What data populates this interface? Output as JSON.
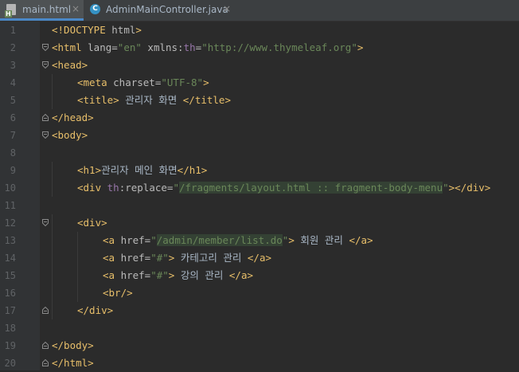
{
  "tabs": [
    {
      "label": "main.html",
      "icon": "html-file-icon",
      "active": true
    },
    {
      "label": "AdminMainController.java",
      "icon": "java-class-icon",
      "active": false
    }
  ],
  "close_glyph": "×",
  "lines": [
    {
      "n": "1",
      "fold": "",
      "indent": 0,
      "tokens": [
        [
          "t",
          "<!DOCTYPE "
        ],
        [
          "a",
          "html"
        ],
        [
          "t",
          ">"
        ]
      ]
    },
    {
      "n": "2",
      "fold": "open",
      "indent": 0,
      "tokens": [
        [
          "t",
          "<html "
        ],
        [
          "a",
          "lang="
        ],
        [
          "s",
          "\"en\""
        ],
        [
          "a",
          " xmlns:"
        ],
        [
          "ns",
          "th"
        ],
        [
          "a",
          "="
        ],
        [
          "s",
          "\"http://www.thymeleaf.org\""
        ],
        [
          "t",
          ">"
        ]
      ]
    },
    {
      "n": "3",
      "fold": "open",
      "indent": 0,
      "tokens": [
        [
          "t",
          "<head>"
        ]
      ]
    },
    {
      "n": "4",
      "fold": "",
      "indent": 1,
      "tokens": [
        [
          "t",
          "<meta "
        ],
        [
          "a",
          "charset="
        ],
        [
          "s",
          "\"UTF-8\""
        ],
        [
          "t",
          ">"
        ]
      ]
    },
    {
      "n": "5",
      "fold": "",
      "indent": 1,
      "tokens": [
        [
          "t",
          "<title>"
        ],
        [
          "tx",
          " 관리자 화면 "
        ],
        [
          "t",
          "</title>"
        ]
      ]
    },
    {
      "n": "6",
      "fold": "close",
      "indent": 0,
      "tokens": [
        [
          "t",
          "</head>"
        ]
      ]
    },
    {
      "n": "7",
      "fold": "open",
      "indent": 0,
      "tokens": [
        [
          "t",
          "<body>"
        ]
      ]
    },
    {
      "n": "8",
      "fold": "",
      "indent": 0,
      "tokens": []
    },
    {
      "n": "9",
      "fold": "",
      "indent": 1,
      "tokens": [
        [
          "t",
          "<h1>"
        ],
        [
          "tx",
          "관리자 메인 화면"
        ],
        [
          "t",
          "</h1>"
        ]
      ]
    },
    {
      "n": "10",
      "fold": "",
      "indent": 1,
      "tokens": [
        [
          "t",
          "<div "
        ],
        [
          "ns",
          "th"
        ],
        [
          "a",
          ":replace="
        ],
        [
          "s",
          "\""
        ],
        [
          "hl",
          "/fragments/layout.html :: fragment-body-menu"
        ],
        [
          "s",
          "\""
        ],
        [
          "t",
          "></div>"
        ]
      ]
    },
    {
      "n": "11",
      "fold": "",
      "indent": 0,
      "tokens": []
    },
    {
      "n": "12",
      "fold": "open",
      "indent": 1,
      "tokens": [
        [
          "t",
          "<div>"
        ]
      ]
    },
    {
      "n": "13",
      "fold": "",
      "indent": 2,
      "tokens": [
        [
          "t",
          "<a "
        ],
        [
          "a",
          "href="
        ],
        [
          "s",
          "\""
        ],
        [
          "hl",
          "/admin/member/list.do"
        ],
        [
          "s",
          "\""
        ],
        [
          "t",
          ">"
        ],
        [
          "tx",
          " 회원 관리 "
        ],
        [
          "t",
          "</a>"
        ]
      ]
    },
    {
      "n": "14",
      "fold": "",
      "indent": 2,
      "tokens": [
        [
          "t",
          "<a "
        ],
        [
          "a",
          "href="
        ],
        [
          "s",
          "\"#\""
        ],
        [
          "t",
          ">"
        ],
        [
          "tx",
          " 카테고리 관리 "
        ],
        [
          "t",
          "</a>"
        ]
      ]
    },
    {
      "n": "15",
      "fold": "",
      "indent": 2,
      "tokens": [
        [
          "t",
          "<a "
        ],
        [
          "a",
          "href="
        ],
        [
          "s",
          "\"#\""
        ],
        [
          "t",
          ">"
        ],
        [
          "tx",
          " 강의 관리 "
        ],
        [
          "t",
          "</a>"
        ]
      ]
    },
    {
      "n": "16",
      "fold": "",
      "indent": 2,
      "tokens": [
        [
          "t",
          "<br/>"
        ]
      ]
    },
    {
      "n": "17",
      "fold": "close",
      "indent": 1,
      "tokens": [
        [
          "t",
          "</div>"
        ]
      ]
    },
    {
      "n": "18",
      "fold": "",
      "indent": 0,
      "tokens": []
    },
    {
      "n": "19",
      "fold": "close",
      "indent": 0,
      "tokens": [
        [
          "t",
          "</body>"
        ]
      ]
    },
    {
      "n": "20",
      "fold": "close",
      "indent": 0,
      "tokens": [
        [
          "t",
          "</html>"
        ]
      ]
    }
  ]
}
